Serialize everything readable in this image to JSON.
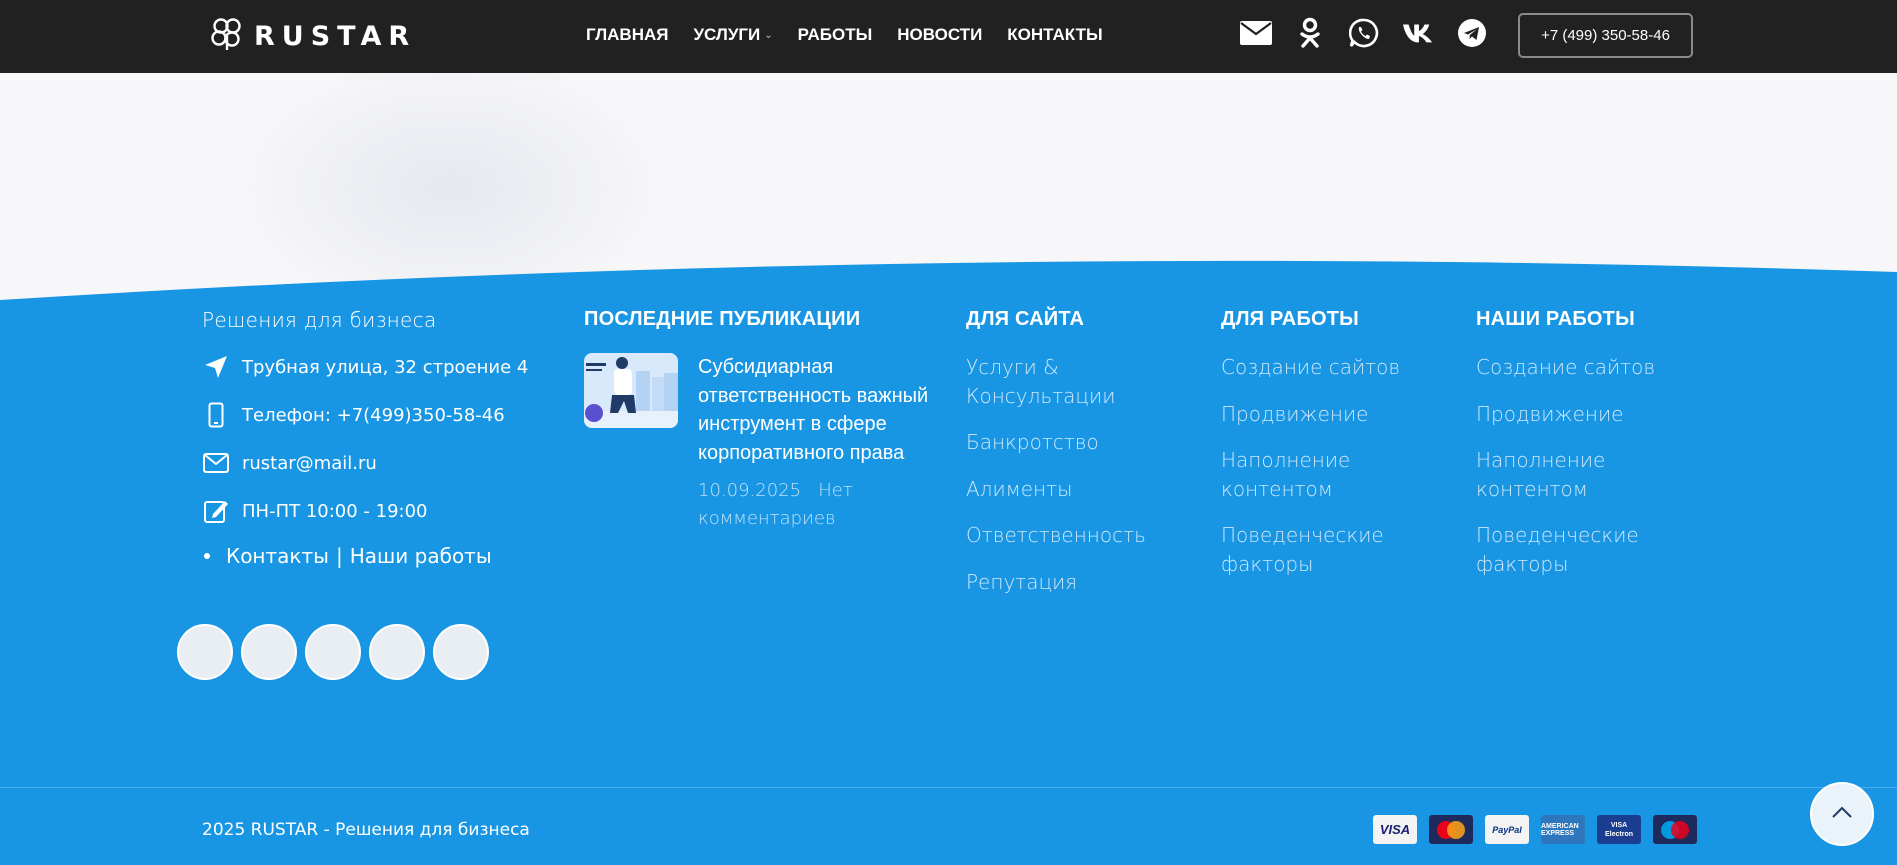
{
  "header": {
    "logo_text": "RUSTAR",
    "nav": [
      {
        "label": "ГЛАВНАЯ",
        "has_dropdown": false
      },
      {
        "label": "УСЛУГИ",
        "has_dropdown": true
      },
      {
        "label": "РАБОТЫ",
        "has_dropdown": false
      },
      {
        "label": "НОВОСТИ",
        "has_dropdown": false
      },
      {
        "label": "КОНТАКТЫ",
        "has_dropdown": false
      }
    ],
    "socials": [
      "mail-icon",
      "odnoklassniki-icon",
      "whatsapp-icon",
      "vk-icon",
      "telegram-icon"
    ],
    "phone": "+7 (499) 350-58-46"
  },
  "footer": {
    "tagline": "Решения для бизнеса",
    "address": "Трубная улица, 32 строение 4",
    "phone": "Телефон: +7(499)350-58-46",
    "email": "rustar@mail.ru",
    "hours": "ПН-ПТ 10:00 - 19:00",
    "links": {
      "contacts": "Контакты",
      "separator": "|",
      "works": "Наши работы"
    },
    "columns": {
      "publications": {
        "title": "ПОСЛЕДНИЕ ПУБЛИКАЦИИ",
        "post_title": "Субсидиарная ответственность важный инструмент в сфере корпоративного права",
        "post_date": "10.09.2025",
        "post_comments": "Нет комментариев"
      },
      "for_site": {
        "title": "ДЛЯ САЙТА",
        "items": [
          "Услуги & Консультации",
          "Банкротство",
          "Алименты",
          "Ответственность",
          "Репутация"
        ]
      },
      "for_work": {
        "title": "ДЛЯ РАБОТЫ",
        "items": [
          "Создание сайтов",
          "Продвижение",
          "Наполнение контентом",
          "Поведенческие факторы"
        ]
      },
      "our_works": {
        "title": "НАШИ РАБОТЫ",
        "items": [
          "Создание сайтов",
          "Продвижение",
          "Наполнение контентом",
          "Поведенческие факторы"
        ]
      }
    },
    "copyright": "2025 RUSTAR - Решения для бизнеса",
    "payments": {
      "visa": "VISA",
      "mastercard": "MasterCard",
      "paypal": "PayPal",
      "amex": "AMERICAN EXPRESS",
      "visa_electron_top": "VISA",
      "visa_electron_bottom": "Electron",
      "maestro": "Maestro"
    }
  },
  "colors": {
    "header_bg": "#212121",
    "footer_bg": "#1896e4",
    "hero_bg": "#f7f7f9"
  }
}
